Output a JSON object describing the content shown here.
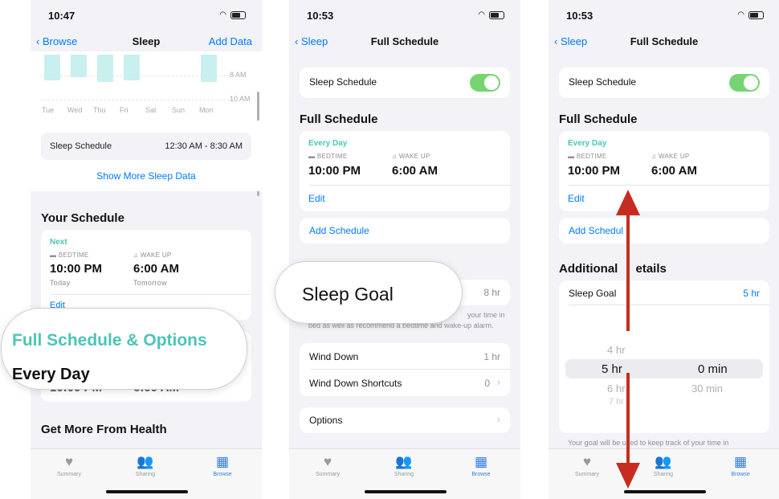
{
  "p1": {
    "time": "10:47",
    "nav": {
      "back": "Browse",
      "title": "Sleep",
      "action": "Add Data"
    },
    "chart_data": {
      "type": "bar",
      "categories": [
        "Tue",
        "Wed",
        "Thu",
        "Fri",
        "Sat",
        "Sun",
        "Mon"
      ],
      "axis_labels": [
        "8 AM",
        "10 AM"
      ]
    },
    "summary_row": {
      "label": "Sleep Schedule",
      "value": "12:30 AM - 8:30 AM"
    },
    "show_more": "Show More Sleep Data",
    "schedule_title": "Your Schedule",
    "next": {
      "tag": "Next",
      "bed_label": "BEDTIME",
      "bed_time": "10:00 PM",
      "bed_sub": "Today",
      "wake_label": "WAKE UP",
      "wake_time": "6:00 AM",
      "wake_sub": "Tomorrow",
      "edit": "Edit"
    },
    "obscured": {
      "bed_time": "10:00 PM",
      "wake_time": "6:00 AM"
    },
    "more_title": "Get More From Health",
    "zoom": {
      "title": "Full Schedule & Options",
      "sub": "Every Day"
    }
  },
  "p2": {
    "time": "10:53",
    "nav": {
      "back": "Sleep",
      "title": "Full Schedule"
    },
    "sleep_schedule_label": "Sleep Schedule",
    "section_title": "Full Schedule",
    "schedule": {
      "tag": "Every Day",
      "bed_label": "BEDTIME",
      "bed_time": "10:00 PM",
      "wake_label": "WAKE UP",
      "wake_time": "6:00 AM",
      "edit": "Edit"
    },
    "add_schedule": "Add Schedule",
    "goal_value": "8 hr",
    "footnote": "bed as well as recommend a bedtime and wake-up alarm.",
    "footnote_tail": "your time in",
    "wind_down": {
      "label": "Wind Down",
      "value": "1 hr"
    },
    "shortcuts": {
      "label": "Wind Down Shortcuts",
      "value": "0"
    },
    "options": "Options",
    "zoom": "Sleep Goal"
  },
  "p3": {
    "time": "10:53",
    "nav": {
      "back": "Sleep",
      "title": "Full Schedule"
    },
    "sleep_schedule_label": "Sleep Schedule",
    "section_title": "Full Schedule",
    "schedule": {
      "tag": "Every Day",
      "bed_label": "BEDTIME",
      "bed_time": "10:00 PM",
      "wake_label": "WAKE UP",
      "wake_time": "6:00 AM",
      "edit": "Edit"
    },
    "add_schedule": "Add Schedul",
    "additional_title_a": "Additional ",
    "additional_title_b": "etails",
    "goal": {
      "label": "Sleep Goal",
      "value": "5 hr"
    },
    "picker": {
      "hours": [
        "4 hr",
        "5 hr",
        "6 hr",
        "7 hr"
      ],
      "minutes": [
        "0 min",
        "30 min"
      ]
    },
    "footnote": "Your goal will be used to keep track of your time in"
  },
  "tabs": [
    "Summary",
    "Sharing",
    "Browse"
  ]
}
